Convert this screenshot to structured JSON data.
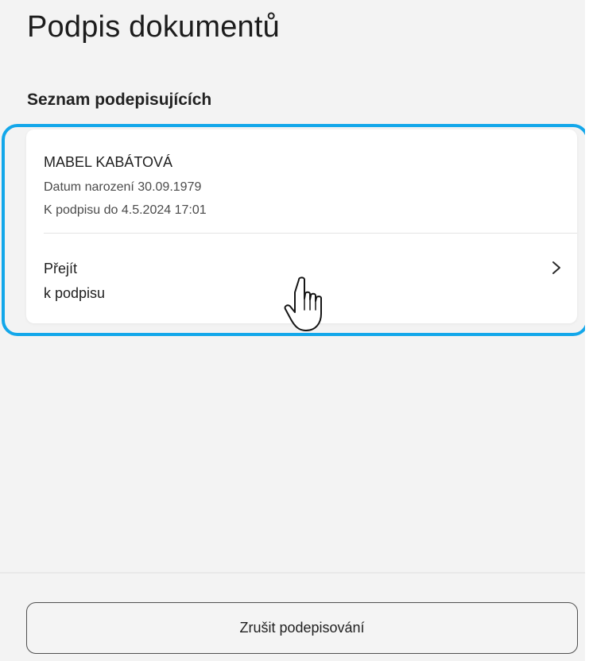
{
  "page": {
    "title": "Podpis dokumentů",
    "section_title": "Seznam podepisujících"
  },
  "signers": [
    {
      "name": "MABEL KABÁTOVÁ",
      "birth_date": "Datum narození 30.09.1979",
      "deadline": "K podpisu do 4.5.2024 17:01",
      "action_line_1": "Přejít",
      "action_line_2": "k podpisu",
      "action_icon": "chevron-right-icon"
    }
  ],
  "footer": {
    "cancel_label": "Zrušit podepisování"
  },
  "overlay": {
    "highlight_color": "#13a7ea",
    "cursor_icon": "hand-cursor-icon"
  }
}
